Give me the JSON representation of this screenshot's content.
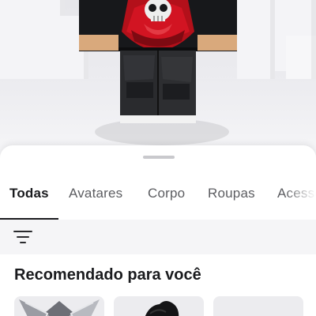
{
  "preview": {
    "avatar": "roblox-avatar-skull-hoodie"
  },
  "tabs": [
    {
      "label": "Todas",
      "active": true
    },
    {
      "label": "Avatares",
      "active": false
    },
    {
      "label": "Corpo",
      "active": false
    },
    {
      "label": "Roupas",
      "active": false
    },
    {
      "label": "Acessórios",
      "active": false
    }
  ],
  "filter": {
    "icon": "filter-icon"
  },
  "section": {
    "title": "Recomendado para você",
    "items": [
      {
        "thumbnail": "silver-wings-accessory"
      },
      {
        "thumbnail": "black-hair-accessory"
      },
      {
        "thumbnail": "empty-thumbnail"
      }
    ]
  },
  "colors": {
    "accent_text": "#1a1b1e",
    "inactive_text": "#5c5d61",
    "hoodie_red": "#c0111c",
    "hoodie_black": "#17181b"
  }
}
